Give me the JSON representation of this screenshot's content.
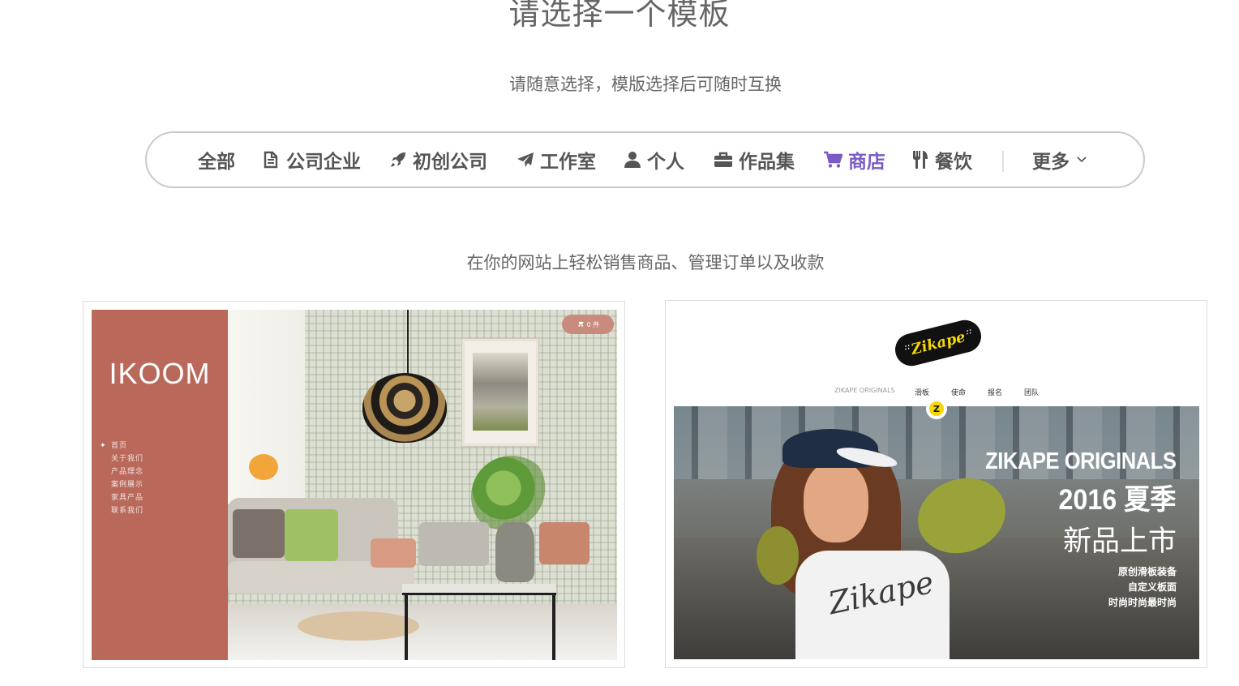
{
  "header": {
    "title": "请选择一个模板",
    "subtitle": "请随意选择，模版选择后可随时互换"
  },
  "categories": [
    {
      "label": "全部",
      "icon": "none",
      "active": false
    },
    {
      "label": "公司企业",
      "icon": "document-icon",
      "active": false
    },
    {
      "label": "初创公司",
      "icon": "rocket-icon",
      "active": false
    },
    {
      "label": "工作室",
      "icon": "paper-plane-icon",
      "active": false
    },
    {
      "label": "个人",
      "icon": "user-icon",
      "active": false
    },
    {
      "label": "作品集",
      "icon": "briefcase-icon",
      "active": false
    },
    {
      "label": "商店",
      "icon": "cart-icon",
      "active": true
    },
    {
      "label": "餐饮",
      "icon": "utensils-icon",
      "active": false
    },
    {
      "label": "更多",
      "icon": "chevron-down-icon",
      "active": false
    }
  ],
  "colors": {
    "active": "#7a5bc4",
    "text": "#555555",
    "ikoom_sidebar": "#b9685a",
    "zikape_yellow": "#f6d800"
  },
  "section": {
    "description": "在你的网站上轻松销售商品、管理订单以及收款"
  },
  "templates": [
    {
      "name": "ikoom",
      "logo": "IKOOM",
      "cart": "0 件",
      "menu": [
        "首页",
        "关于我们",
        "产品理念",
        "案例展示",
        "家具产品",
        "联系我们"
      ]
    },
    {
      "name": "zikape",
      "logo": "Zikape",
      "nav": [
        "ZIKAPE ORIGINALS",
        "滑板",
        "使命",
        "报名",
        "团队"
      ],
      "badge": "Z",
      "shirt_text": "Zikape",
      "headline": "ZIKAPE ORIGINALS",
      "headline_2": "2016 夏季",
      "headline_3": "新品上市",
      "subs": [
        "原创滑板装备",
        "自定义板面",
        "时尚时尚最时尚"
      ]
    }
  ]
}
